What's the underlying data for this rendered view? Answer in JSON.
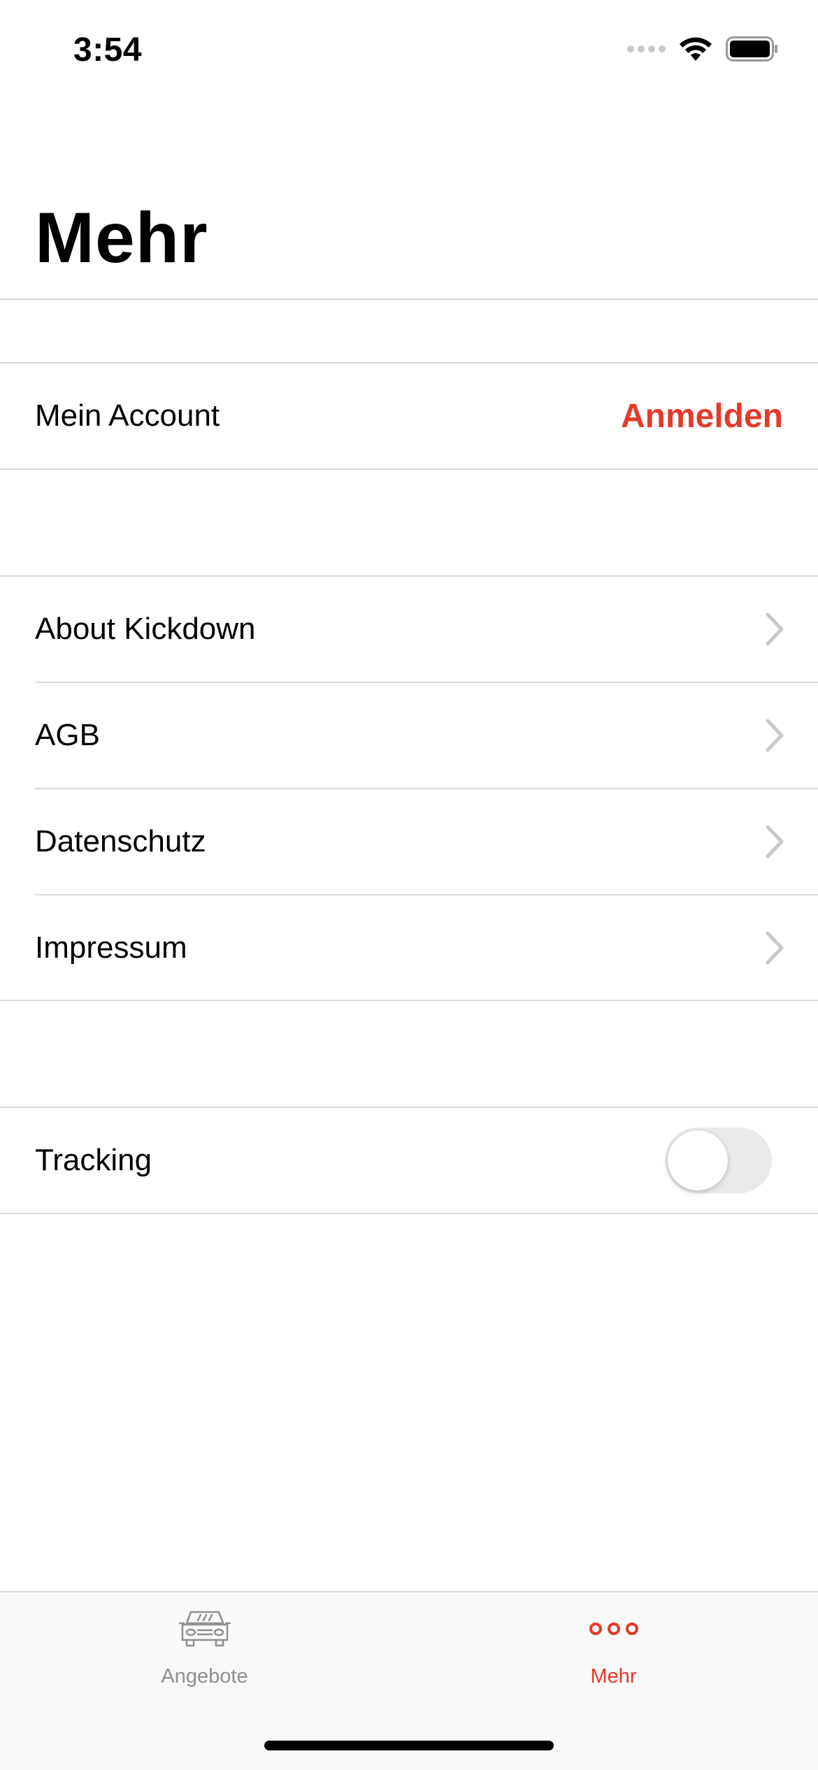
{
  "status_bar": {
    "time": "3:54"
  },
  "nav": {
    "title": "Mehr"
  },
  "account_section": {
    "label": "Mein Account",
    "action": "Anmelden"
  },
  "info_section": {
    "items": [
      {
        "label": "About Kickdown"
      },
      {
        "label": "AGB"
      },
      {
        "label": "Datenschutz"
      },
      {
        "label": "Impressum"
      }
    ]
  },
  "tracking_section": {
    "label": "Tracking",
    "toggle_on": false
  },
  "tab_bar": {
    "tabs": [
      {
        "label": "Angebote",
        "icon": "car-icon",
        "active": false
      },
      {
        "label": "Mehr",
        "icon": "more-dots-icon",
        "active": true
      }
    ]
  },
  "colors": {
    "accent": "#e5392a",
    "separator": "#d9d9dc",
    "chevron": "#c7c7cc",
    "inactive_tab": "#8e8e93"
  }
}
